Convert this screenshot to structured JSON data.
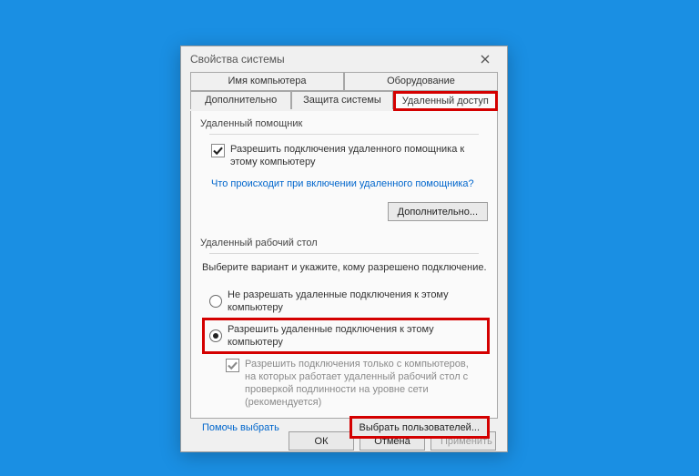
{
  "window": {
    "title": "Свойства системы"
  },
  "tabs": {
    "row1": [
      "Имя компьютера",
      "Оборудование"
    ],
    "row2": [
      "Дополнительно",
      "Защита системы",
      "Удаленный доступ"
    ],
    "active": "Удаленный доступ"
  },
  "remote_assist": {
    "group": "Удаленный помощник",
    "allow_label": "Разрешить подключения удаленного помощника к этому компьютеру",
    "allow_checked": true,
    "help_link": "Что происходит при включении удаленного помощника?",
    "advanced_btn": "Дополнительно..."
  },
  "remote_desktop": {
    "group": "Удаленный рабочий стол",
    "hint": "Выберите вариант и укажите, кому разрешено подключение.",
    "opt_disallow": "Не разрешать удаленные подключения к этому компьютеру",
    "opt_allow": "Разрешить удаленные подключения к этому компьютеру",
    "selected": "allow",
    "nla_label": "Разрешить подключения только с компьютеров, на которых работает удаленный рабочий стол с проверкой подлинности на уровне сети (рекомендуется)",
    "nla_checked": true,
    "help_link": "Помочь выбрать",
    "users_btn": "Выбрать пользователей..."
  },
  "buttons": {
    "ok": "ОК",
    "cancel": "Отмена",
    "apply": "Применить"
  }
}
